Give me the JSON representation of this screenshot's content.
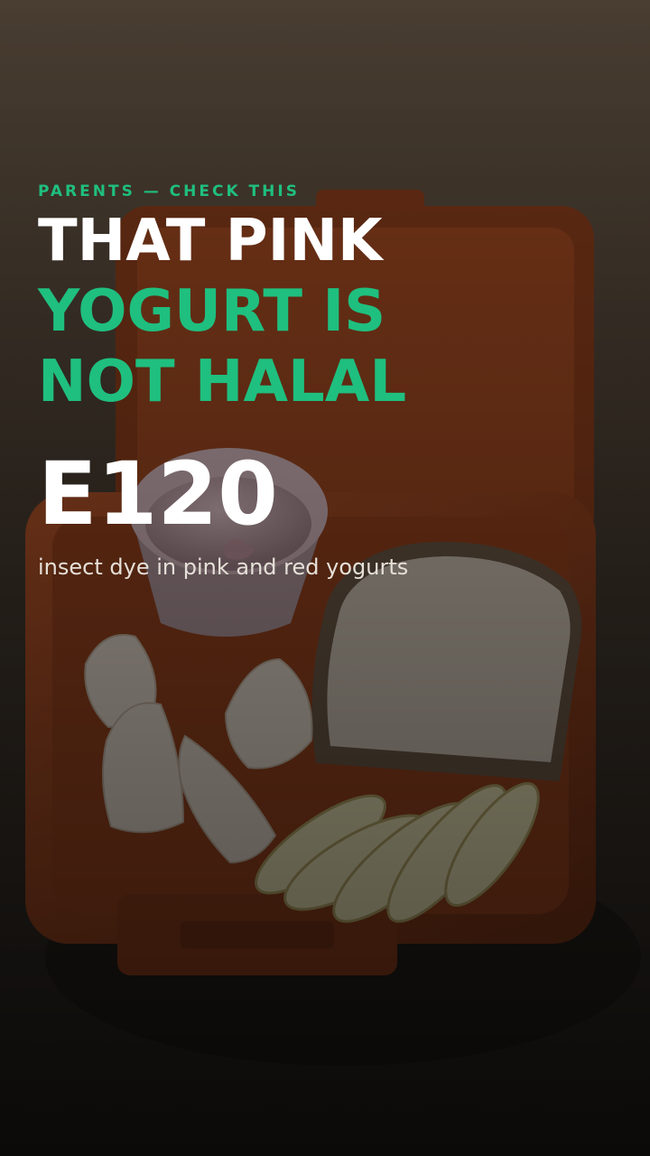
{
  "eyebrow": "PARENTS — CHECK THIS",
  "headline": {
    "line1": "THAT PINK",
    "line2": "YOGURT IS",
    "line3": "NOT HALAL"
  },
  "code": "E120",
  "caption": "insect dye in pink and red yogurts",
  "colors": {
    "accent": "#1fbf7f",
    "text": "#ffffff"
  }
}
